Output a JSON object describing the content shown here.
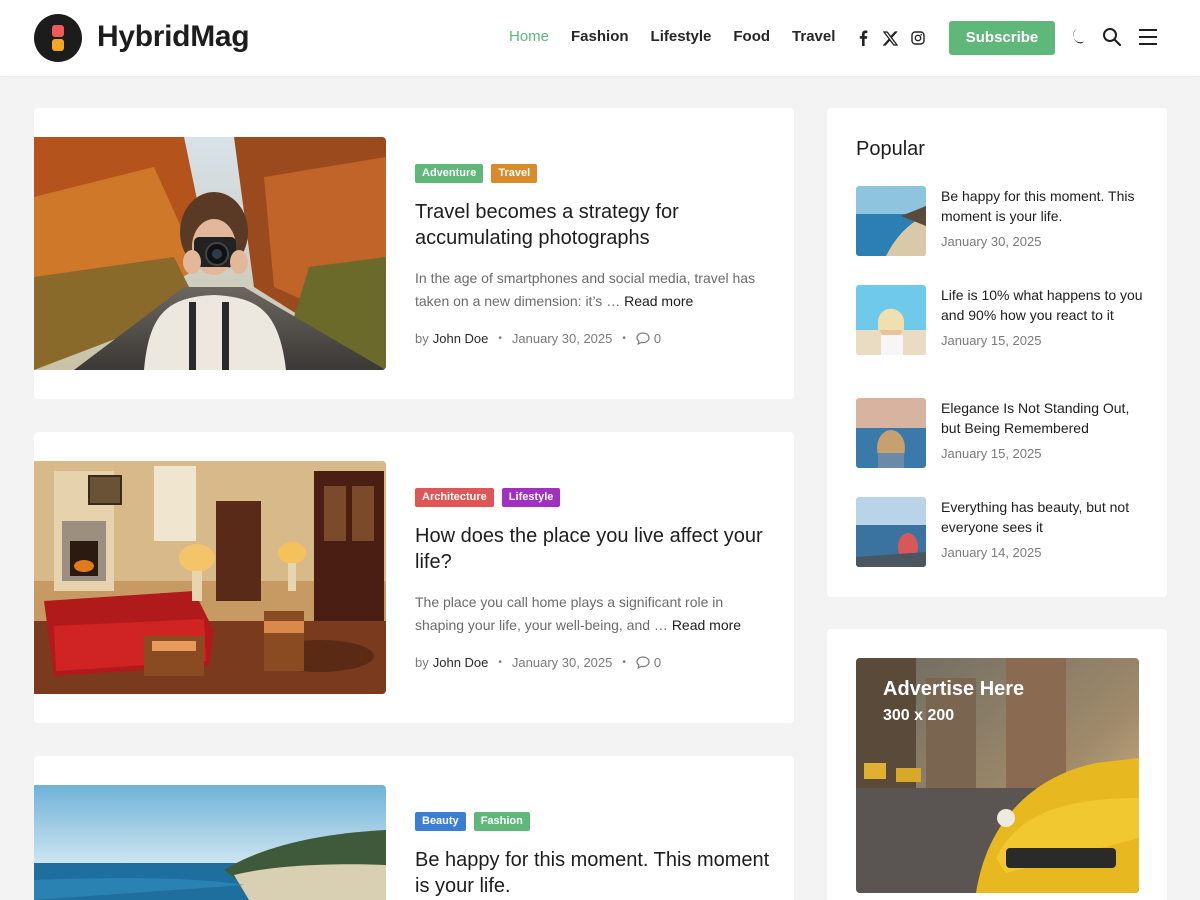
{
  "site": {
    "title": "HybridMag",
    "brand_color": "#5fb87a"
  },
  "nav": {
    "items": [
      {
        "label": "Home",
        "active": true
      },
      {
        "label": "Fashion"
      },
      {
        "label": "Lifestyle"
      },
      {
        "label": "Food"
      },
      {
        "label": "Travel"
      }
    ],
    "social_icons": [
      "facebook-icon",
      "x-icon",
      "instagram-icon"
    ],
    "subscribe_label": "Subscribe",
    "utility_icons": [
      "moon-icon",
      "search-icon",
      "menu-icon"
    ]
  },
  "posts": [
    {
      "tags": [
        {
          "label": "Adventure",
          "color": "#5fb87a"
        },
        {
          "label": "Travel",
          "color": "#d98a2b"
        }
      ],
      "title": "Travel becomes a strategy for accumulating photographs",
      "excerpt": "In the age of smartphones and social media, travel has taken on a new dimension: it’s …",
      "read_more": "Read more",
      "by": "by",
      "author": "John Doe",
      "date": "January 30, 2025",
      "comments": "0"
    },
    {
      "tags": [
        {
          "label": "Architecture",
          "color": "#e05656"
        },
        {
          "label": "Lifestyle",
          "color": "#a12fc2"
        }
      ],
      "title": "How does the place you live affect your life?",
      "excerpt": "The place you call home plays a significant role in shaping your life, your well-being, and …",
      "read_more": "Read more",
      "by": "by",
      "author": "John Doe",
      "date": "January 30, 2025",
      "comments": "0"
    },
    {
      "tags": [
        {
          "label": "Beauty",
          "color": "#3b7fd4"
        },
        {
          "label": "Fashion",
          "color": "#5fb87a"
        }
      ],
      "title": "Be happy for this moment. This moment is your life."
    }
  ],
  "sidebar": {
    "popular_title": "Popular",
    "popular": [
      {
        "title": "Be happy for this moment. This moment is your life.",
        "date": "January 30, 2025"
      },
      {
        "title": "Life is 10% what happens to you and 90% how you react to it",
        "date": "January 15, 2025"
      },
      {
        "title": "Elegance Is Not Standing Out, but Being Remembered",
        "date": "January 15, 2025"
      },
      {
        "title": "Everything has beauty, but not everyone sees it",
        "date": "January 14, 2025"
      }
    ],
    "ad": {
      "title": "Advertise Here",
      "size": "300 x 200"
    }
  }
}
